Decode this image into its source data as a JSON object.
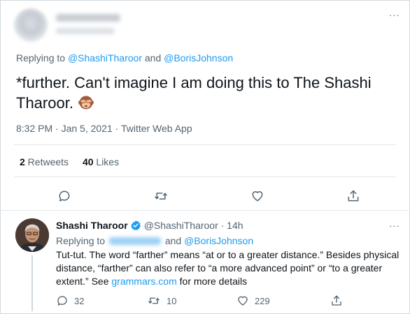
{
  "main_tweet": {
    "replying_prefix": "Replying to ",
    "mention_1": "@ShashiTharoor",
    "and_word": " and ",
    "mention_2": "@BorisJohnson",
    "text": "*further. Can't imagine I am doing this to The Shashi Tharoor.",
    "emoji_icon": "see-no-evil-monkey-icon",
    "meta": "8:32 PM · Jan 5, 2021 · Twitter Web App",
    "retweets_count": "2",
    "retweets_label": " Retweets",
    "likes_count": "40",
    "likes_label": " Likes",
    "more_label": "···"
  },
  "reply": {
    "name": "Shashi Tharoor",
    "handle_time": "@ShashiTharoor · 14h",
    "replying_prefix": "Replying to ",
    "and_word": " and ",
    "mention_2": "@BorisJohnson",
    "body_1": "Tut-tut. The word “farther” means “at or to a greater distance.” Besides physical distance, “farther” can also refer to “a more advanced point” or “to a greater extent.” See ",
    "link": "grammars.com",
    "body_2": " for more details",
    "reply_count": "32",
    "retweet_count": "10",
    "like_count": "229",
    "more_label": "···"
  },
  "colors": {
    "accent": "#1d9bf0",
    "secondary_text": "#536471",
    "primary_text": "#0f1419"
  }
}
